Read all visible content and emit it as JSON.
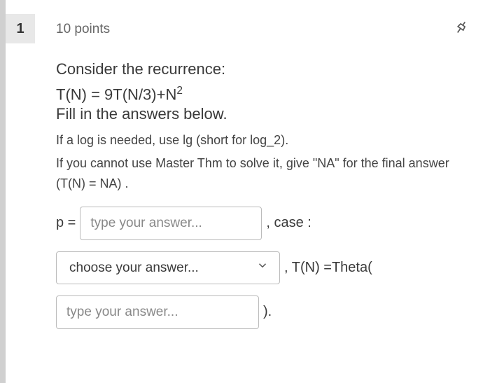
{
  "question": {
    "number": "1",
    "points": "10 points",
    "prompt_line1": "Consider the recurrence:",
    "formula_prefix": "T(N) = 9T(N/3)+N",
    "formula_exponent": "2",
    "prompt_line2": "Fill in the answers below.",
    "note1": "If a log is needed, use lg (short for log_2).",
    "note2": "If you cannot use Master Thm to solve it, give \"NA\" for the final answer (T(N) = NA) ."
  },
  "answers": {
    "p_label": "p =",
    "p_placeholder": "type your answer...",
    "case_label": ", case :",
    "select_placeholder": "choose your answer...",
    "tn_label": ", T(N) =Theta(",
    "final_placeholder": "type your answer...",
    "close_paren": ")."
  }
}
